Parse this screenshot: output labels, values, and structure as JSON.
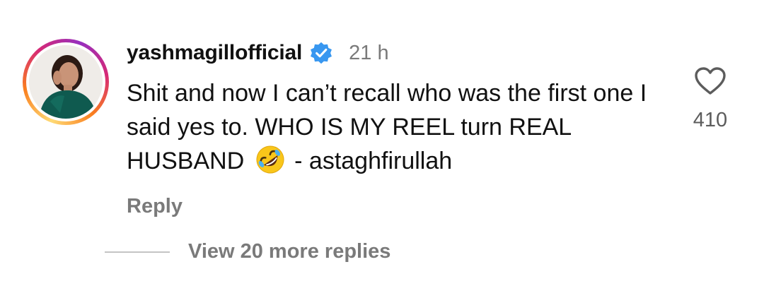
{
  "comment": {
    "username": "yashmagillofficial",
    "timestamp": "21 h",
    "text_before_emoji": "Shit and now I can’t recall who was the first one I said yes to. WHO IS MY REEL turn REAL HUSBAND",
    "emoji": "rolling-on-floor-laughing",
    "text_after_emoji": " - astaghfirullah",
    "reply_label": "Reply",
    "like_count": "410",
    "verified_color": "#3897f0"
  },
  "thread": {
    "view_replies_label": "View 20 more replies"
  },
  "icons": {
    "avatar": "profile-photo",
    "verified": "verified-badge-icon",
    "like": "heart-outline-icon"
  }
}
